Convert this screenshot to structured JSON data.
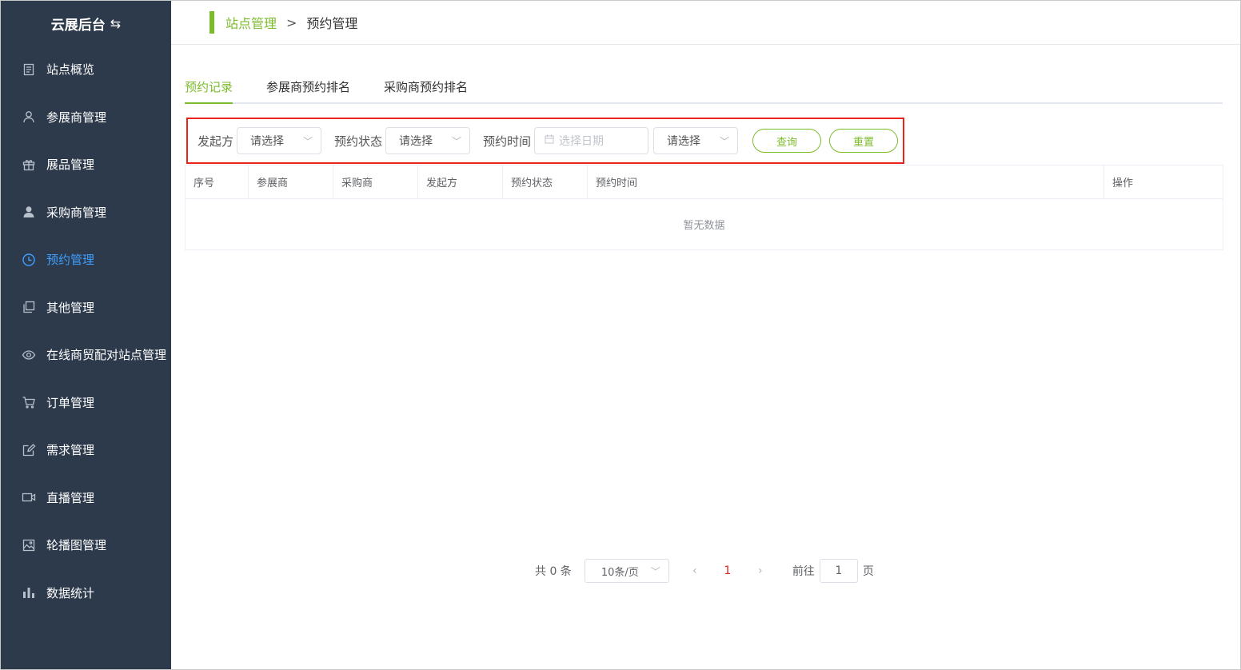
{
  "sidebar": {
    "brand": "云展后台",
    "brand_icon": "swap-icon",
    "items": [
      {
        "label": "站点概览",
        "icon": "document-icon"
      },
      {
        "label": "参展商管理",
        "icon": "user-outline-icon"
      },
      {
        "label": "展品管理",
        "icon": "gift-icon"
      },
      {
        "label": "采购商管理",
        "icon": "user-solid-icon"
      },
      {
        "label": "预约管理",
        "icon": "clock-icon",
        "active": true
      },
      {
        "label": "其他管理",
        "icon": "copy-icon"
      },
      {
        "label": "在线商贸配对站点管理",
        "icon": "eye-icon"
      },
      {
        "label": "订单管理",
        "icon": "cart-icon"
      },
      {
        "label": "需求管理",
        "icon": "edit-icon"
      },
      {
        "label": "直播管理",
        "icon": "video-icon"
      },
      {
        "label": "轮播图管理",
        "icon": "picture-icon"
      },
      {
        "label": "数据统计",
        "icon": "bar-chart-icon"
      }
    ]
  },
  "breadcrumb": {
    "first": "站点管理",
    "separator": ">",
    "current": "预约管理"
  },
  "tabs": [
    {
      "label": "预约记录",
      "active": true
    },
    {
      "label": "参展商预约排名"
    },
    {
      "label": "采购商预约排名"
    }
  ],
  "filter": {
    "initiator_label": "发起方",
    "initiator_value": "请选择",
    "status_label": "预约状态",
    "status_value": "请选择",
    "time_label": "预约时间",
    "date_placeholder": "选择日期",
    "time_select_value": "请选择",
    "query_button": "查询",
    "reset_button": "重置"
  },
  "table": {
    "columns": [
      "序号",
      "参展商",
      "采购商",
      "发起方",
      "预约状态",
      "预约时间",
      "操作"
    ],
    "empty_text": "暂无数据"
  },
  "pagination": {
    "total_text": "共 0 条",
    "page_size": "10条/页",
    "current_page": "1",
    "goto_label": "前往",
    "goto_value": "1",
    "page_suffix": "页"
  },
  "colors": {
    "sidebar_bg": "#2d3a4b",
    "accent_green": "#7cbb2d",
    "active_blue": "#409eff",
    "highlight_red": "#e8231e"
  }
}
